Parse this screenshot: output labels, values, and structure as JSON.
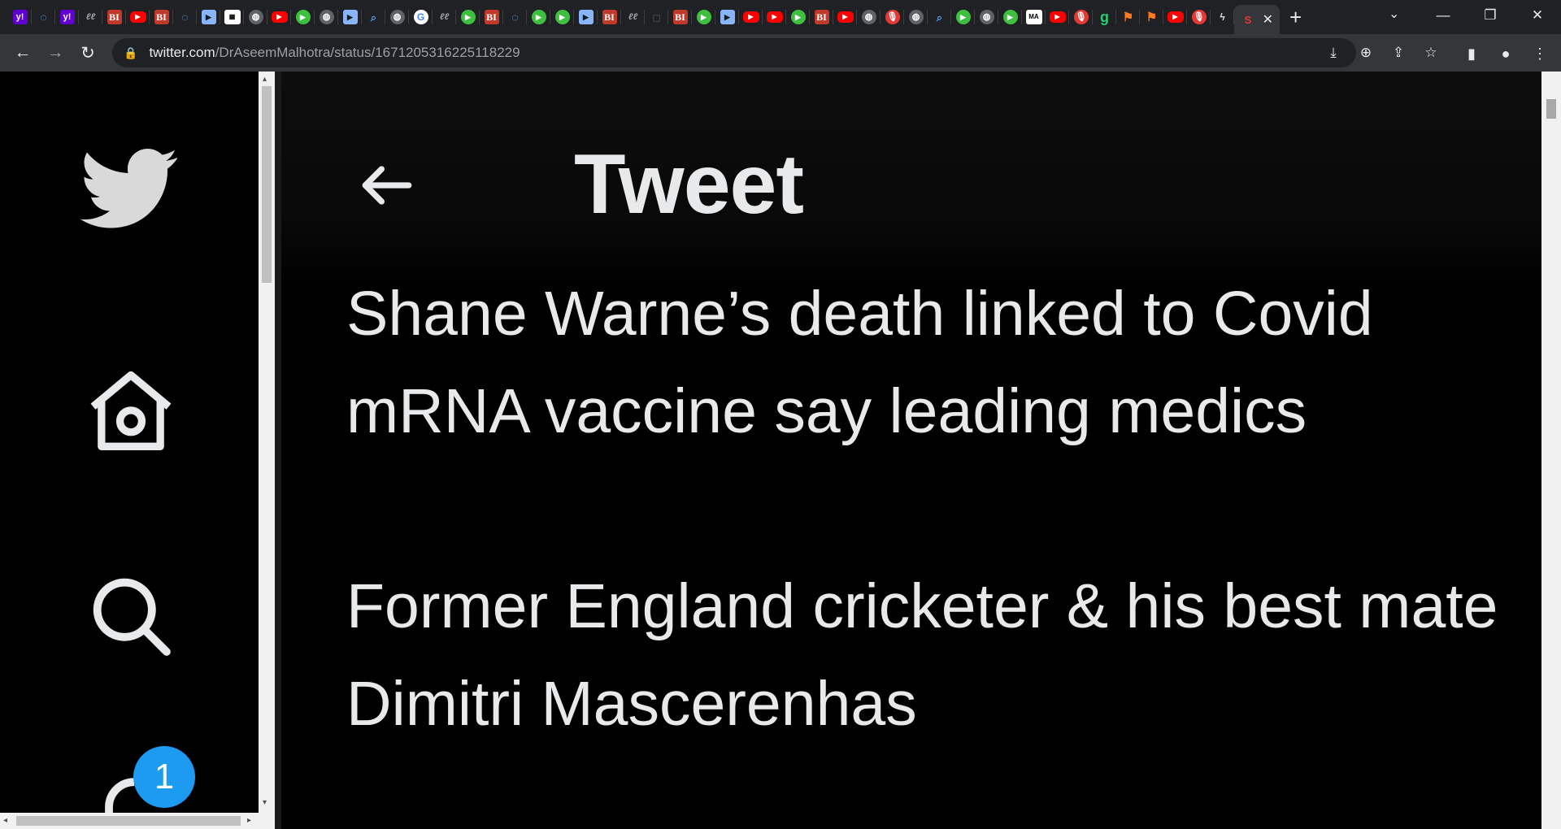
{
  "browser": {
    "tabs": [
      {
        "icon": "yahoo-icon",
        "glyph": "y!",
        "cls": "yahoo"
      },
      {
        "icon": "loop-icon",
        "glyph": "◌",
        "cls": "loop"
      },
      {
        "icon": "yahoo-icon",
        "glyph": "y!",
        "cls": "yahoo"
      },
      {
        "icon": "ll-icon",
        "glyph": "ℓℓ",
        "cls": "ll"
      },
      {
        "icon": "business-insider-icon",
        "glyph": "BI",
        "cls": "bi"
      },
      {
        "icon": "youtube-icon",
        "glyph": "▶",
        "cls": "yt"
      },
      {
        "icon": "business-insider-icon",
        "glyph": "BI",
        "cls": "bi"
      },
      {
        "icon": "loop-icon",
        "glyph": "◌",
        "cls": "loop"
      },
      {
        "icon": "doc-icon",
        "glyph": "▶",
        "cls": "doc"
      },
      {
        "icon": "pattern-icon",
        "glyph": "▦",
        "cls": "ma"
      },
      {
        "icon": "globe-icon",
        "glyph": "◍",
        "cls": "globe"
      },
      {
        "icon": "youtube-icon",
        "glyph": "▶",
        "cls": "yt"
      },
      {
        "icon": "play-icon",
        "glyph": "▶",
        "cls": "play"
      },
      {
        "icon": "globe-icon",
        "glyph": "◍",
        "cls": "globe"
      },
      {
        "icon": "doc-icon",
        "glyph": "▶",
        "cls": "doc"
      },
      {
        "icon": "seek-icon",
        "glyph": "⌕",
        "cls": "seek"
      },
      {
        "icon": "globe-icon",
        "glyph": "◍",
        "cls": "globe"
      },
      {
        "icon": "google-icon",
        "glyph": "G",
        "cls": "google"
      },
      {
        "icon": "ll-icon",
        "glyph": "ℓℓ",
        "cls": "ll"
      },
      {
        "icon": "play-icon",
        "glyph": "▶",
        "cls": "play"
      },
      {
        "icon": "business-insider-icon",
        "glyph": "BI",
        "cls": "bi"
      },
      {
        "icon": "loop-icon",
        "glyph": "◌",
        "cls": "loop"
      },
      {
        "icon": "play-icon",
        "glyph": "▶",
        "cls": "play"
      },
      {
        "icon": "play-icon",
        "glyph": "▶",
        "cls": "play"
      },
      {
        "icon": "doc-icon",
        "glyph": "▶",
        "cls": "doc"
      },
      {
        "icon": "business-insider-icon",
        "glyph": "BI",
        "cls": "bi"
      },
      {
        "icon": "ll-icon",
        "glyph": "ℓℓ",
        "cls": "ll"
      },
      {
        "icon": "dark-icon",
        "glyph": "◻",
        "cls": "dark"
      },
      {
        "icon": "business-insider-icon",
        "glyph": "BI",
        "cls": "bi"
      },
      {
        "icon": "play-icon",
        "glyph": "▶",
        "cls": "play"
      },
      {
        "icon": "doc-icon",
        "glyph": "▶",
        "cls": "doc"
      },
      {
        "icon": "youtube-icon",
        "glyph": "▶",
        "cls": "yt"
      },
      {
        "icon": "youtube-icon",
        "glyph": "▶",
        "cls": "yt"
      },
      {
        "icon": "play-icon",
        "glyph": "▶",
        "cls": "play"
      },
      {
        "icon": "business-insider-icon",
        "glyph": "BI",
        "cls": "bi"
      },
      {
        "icon": "youtube-icon",
        "glyph": "▶",
        "cls": "yt"
      },
      {
        "icon": "globe-icon",
        "glyph": "◍",
        "cls": "globe"
      },
      {
        "icon": "mic-icon",
        "glyph": "🎙",
        "cls": "mic"
      },
      {
        "icon": "globe-icon",
        "glyph": "◍",
        "cls": "globe"
      },
      {
        "icon": "seek-icon",
        "glyph": "⌕",
        "cls": "seek"
      },
      {
        "icon": "play-icon",
        "glyph": "▶",
        "cls": "play"
      },
      {
        "icon": "globe-icon",
        "glyph": "◍",
        "cls": "globe"
      },
      {
        "icon": "play-icon",
        "glyph": "▶",
        "cls": "play"
      },
      {
        "icon": "ma-icon",
        "glyph": "MA",
        "cls": "ma"
      },
      {
        "icon": "youtube-icon",
        "glyph": "▶",
        "cls": "yt"
      },
      {
        "icon": "mic-icon",
        "glyph": "🎙",
        "cls": "mic"
      },
      {
        "icon": "g-icon",
        "glyph": "g",
        "cls": "g"
      },
      {
        "icon": "bookmark-icon",
        "glyph": "⚑",
        "cls": "bm"
      },
      {
        "icon": "bookmark-icon",
        "glyph": "⚑",
        "cls": "bm"
      },
      {
        "icon": "youtube-icon",
        "glyph": "▶",
        "cls": "yt"
      },
      {
        "icon": "mic-icon",
        "glyph": "🎙",
        "cls": "mic"
      },
      {
        "icon": "pi-icon",
        "glyph": "ϟ",
        "cls": "pi"
      }
    ],
    "active_tab_icon": {
      "icon": "s-icon",
      "glyph": "S",
      "cls": "s"
    },
    "url_host": "twitter.com",
    "url_path": "/DrAseemMalhotra/status/1671205316225118229"
  },
  "tweet": {
    "header_title": "Tweet",
    "paragraphs": [
      "Shane Warne’s death linked to Covid mRNA vaccine say leading medics",
      "Former England cricketer & his best mate Dimitri Mascerenhas"
    ]
  },
  "sidebar": {
    "notification_count": "1"
  },
  "colors": {
    "twitter_blue": "#1d9bf0",
    "text": "#e7e9ea",
    "chrome_dark": "#202124",
    "chrome_toolbar": "#35363a"
  }
}
